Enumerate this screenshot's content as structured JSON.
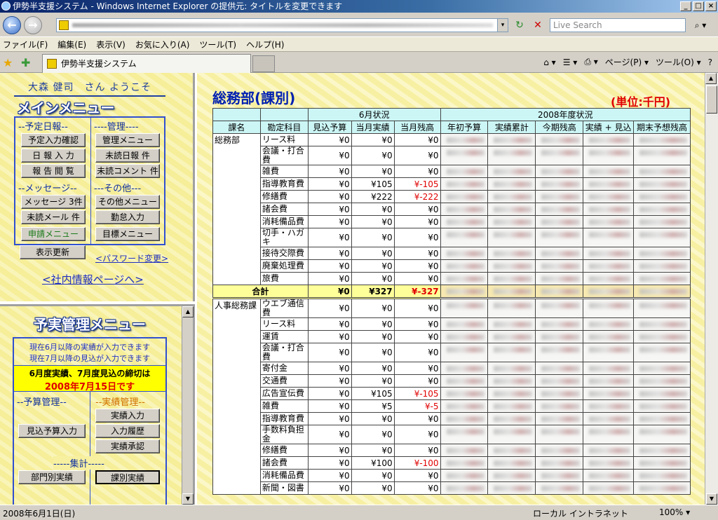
{
  "window": {
    "title": "伊勢半支援システム - Windows Internet Explorer の提供元: タイトルを変更できます",
    "minimize": "_",
    "maximize": "□",
    "close": "×"
  },
  "address": {
    "search_placeholder": "Live Search",
    "back": "←",
    "forward": "→",
    "refresh": "↻",
    "stop": "✕",
    "search_btn": "⌕ ▾",
    "drop": "▾"
  },
  "menu": [
    "ファイル(F)",
    "編集(E)",
    "表示(V)",
    "お気に入り(A)",
    "ツール(T)",
    "ヘルプ(H)"
  ],
  "tab": {
    "label": "伊勢半支援システム"
  },
  "commands": {
    "home": "⌂ ▾",
    "feeds": "☰ ▾",
    "print": "⎙ ▾",
    "page": "ページ(P) ▾",
    "tools": "ツール(O) ▾",
    "help": "?"
  },
  "left": {
    "welcome": "大森 健司　さん ようこそ",
    "main_menu_title": "メインメニュー",
    "sections": {
      "yotei": "--予定日報--",
      "kanri": "----管理----",
      "message": "--メッセージ--",
      "sonota": "---その他---"
    },
    "buttons": {
      "yotei_check": "予定入力確認",
      "nippo_input": "日 報 入 力",
      "report_view": "報 告 閲 覧",
      "kanri_menu": "管理メニュー",
      "unread_nippo": "未読日報 件",
      "unread_comment": "未読コメント 件",
      "message3": "メッセージ 3件",
      "unread_mail": "未読メール 件",
      "sonota_menu": "その他メニュー",
      "kintai": "勤怠入力",
      "shinsei": "申請メニュー",
      "mokuhyo": "目標メニュー",
      "refresh_view": "表示更新"
    },
    "password_link": "<パスワード変更>",
    "intranet_link": "<社内情報ページへ>"
  },
  "yojitsu": {
    "title": "予実管理メニュー",
    "info1": "現在6月以降の実績が入力できます",
    "info2": "現在7月以降の見込が入力できます",
    "deadline1": "6月度実績、7月度見込の締切は",
    "deadline2": "2008年7月15日です",
    "sect_budget": "--予算管理--",
    "sect_actual": "--実績管理--",
    "sect_total": "-----集計-----",
    "btn_mikomi": "見込予算入力",
    "btn_jisseki": "実績入力",
    "btn_history": "入力履歴",
    "btn_approve": "実績承認",
    "btn_dept": "部門別実績",
    "btn_section": "課別実績"
  },
  "right": {
    "title": "総務部(課別)",
    "unit": "(単位:千円)",
    "head": {
      "june": "6月状況",
      "year": "2008年度状況",
      "ka": "課名",
      "kamoku": "勘定科目",
      "mikomi": "見込予算",
      "jisseki": "当月実績",
      "zandaka": "当月残高",
      "nensho": "年初予算",
      "ruikei": "実績累計",
      "kon_zan": "今期残高",
      "jis_mik": "実績 + 見込",
      "kimatsu": "期末予想残高"
    },
    "groups": [
      {
        "name": "総務部",
        "rows": [
          {
            "acct": "リース料",
            "m": "¥0",
            "j": "¥0",
            "z": "¥0",
            "neg": false
          },
          {
            "acct": "会議・打合費",
            "m": "¥0",
            "j": "¥0",
            "z": "¥0",
            "neg": false
          },
          {
            "acct": "雑費",
            "m": "¥0",
            "j": "¥0",
            "z": "¥0",
            "neg": false
          },
          {
            "acct": "指導教育費",
            "m": "¥0",
            "j": "¥105",
            "z": "¥-105",
            "neg": true
          },
          {
            "acct": "修繕費",
            "m": "¥0",
            "j": "¥222",
            "z": "¥-222",
            "neg": true
          },
          {
            "acct": "諸会費",
            "m": "¥0",
            "j": "¥0",
            "z": "¥0",
            "neg": false
          },
          {
            "acct": "消耗備品費",
            "m": "¥0",
            "j": "¥0",
            "z": "¥0",
            "neg": false
          },
          {
            "acct": "切手・ハガキ",
            "m": "¥0",
            "j": "¥0",
            "z": "¥0",
            "neg": false
          },
          {
            "acct": "接待交際費",
            "m": "¥0",
            "j": "¥0",
            "z": "¥0",
            "neg": false
          },
          {
            "acct": "廃棄処理費",
            "m": "¥0",
            "j": "¥0",
            "z": "¥0",
            "neg": false
          },
          {
            "acct": "旅費",
            "m": "¥0",
            "j": "¥0",
            "z": "¥0",
            "neg": false
          }
        ],
        "total": {
          "label": "合計",
          "m": "¥0",
          "j": "¥327",
          "z": "¥-327"
        }
      },
      {
        "name": "人事総務課",
        "rows": [
          {
            "acct": "ウエブ通信費",
            "m": "¥0",
            "j": "¥0",
            "z": "¥0",
            "neg": false
          },
          {
            "acct": "リース料",
            "m": "¥0",
            "j": "¥0",
            "z": "¥0",
            "neg": false
          },
          {
            "acct": "運賃",
            "m": "¥0",
            "j": "¥0",
            "z": "¥0",
            "neg": false
          },
          {
            "acct": "会議・打合費",
            "m": "¥0",
            "j": "¥0",
            "z": "¥0",
            "neg": false
          },
          {
            "acct": "寄付金",
            "m": "¥0",
            "j": "¥0",
            "z": "¥0",
            "neg": false
          },
          {
            "acct": "交通費",
            "m": "¥0",
            "j": "¥0",
            "z": "¥0",
            "neg": false
          },
          {
            "acct": "広告宣伝費",
            "m": "¥0",
            "j": "¥105",
            "z": "¥-105",
            "neg": true
          },
          {
            "acct": "雑費",
            "m": "¥0",
            "j": "¥5",
            "z": "¥-5",
            "neg": true
          },
          {
            "acct": "指導教育費",
            "m": "¥0",
            "j": "¥0",
            "z": "¥0",
            "neg": false
          },
          {
            "acct": "手数料負担金",
            "m": "¥0",
            "j": "¥0",
            "z": "¥0",
            "neg": false
          },
          {
            "acct": "修繕費",
            "m": "¥0",
            "j": "¥0",
            "z": "¥0",
            "neg": false
          },
          {
            "acct": "諸会費",
            "m": "¥0",
            "j": "¥100",
            "z": "¥-100",
            "neg": true
          },
          {
            "acct": "消耗備品費",
            "m": "¥0",
            "j": "¥0",
            "z": "¥0",
            "neg": false
          },
          {
            "acct": "新聞・図書",
            "m": "¥0",
            "j": "¥0",
            "z": "¥0",
            "neg": false
          }
        ]
      }
    ]
  },
  "status": {
    "text": "2008年6月1日(日)",
    "zone": "ローカル イントラネット",
    "zoom": "100% ▾"
  }
}
